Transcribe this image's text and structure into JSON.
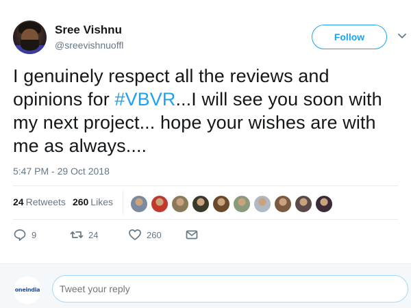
{
  "author": {
    "display_name": "Sree Vishnu",
    "handle": "@sreevishnuoffl"
  },
  "header": {
    "follow_label": "Follow"
  },
  "tweet": {
    "text_before": "I genuinely respect all the reviews and opinions for ",
    "hashtag": "#VBVR",
    "text_after": "...I will see you soon with my next project... hope your wishes are with me as always....",
    "timestamp": "5:47 PM - 29 Oct 2018"
  },
  "stats": {
    "retweets_count": "24",
    "retweets_label": "Retweets",
    "likes_count": "260",
    "likes_label": "Likes"
  },
  "likers": [
    {
      "name": "liker-1",
      "color": "#7a8aa0"
    },
    {
      "name": "liker-2",
      "color": "#c0392b"
    },
    {
      "name": "liker-3",
      "color": "#8a7a5a"
    },
    {
      "name": "liker-4",
      "color": "#3a3a2a"
    },
    {
      "name": "liker-5",
      "color": "#6a4a2a"
    },
    {
      "name": "liker-6",
      "color": "#8a9a7a"
    },
    {
      "name": "liker-7",
      "color": "#b0b8c0"
    },
    {
      "name": "liker-8",
      "color": "#7a5a40"
    },
    {
      "name": "liker-9",
      "color": "#5a4a4a"
    },
    {
      "name": "liker-10",
      "color": "#3a2a3a"
    }
  ],
  "actions": {
    "reply_count": "9",
    "retweet_count": "24",
    "like_count": "260"
  },
  "reply": {
    "placeholder": "Tweet your reply",
    "avatar_brand": "oneindia"
  },
  "colors": {
    "accent": "#1da1f2",
    "text_primary": "#14171a",
    "text_secondary": "#657786"
  }
}
